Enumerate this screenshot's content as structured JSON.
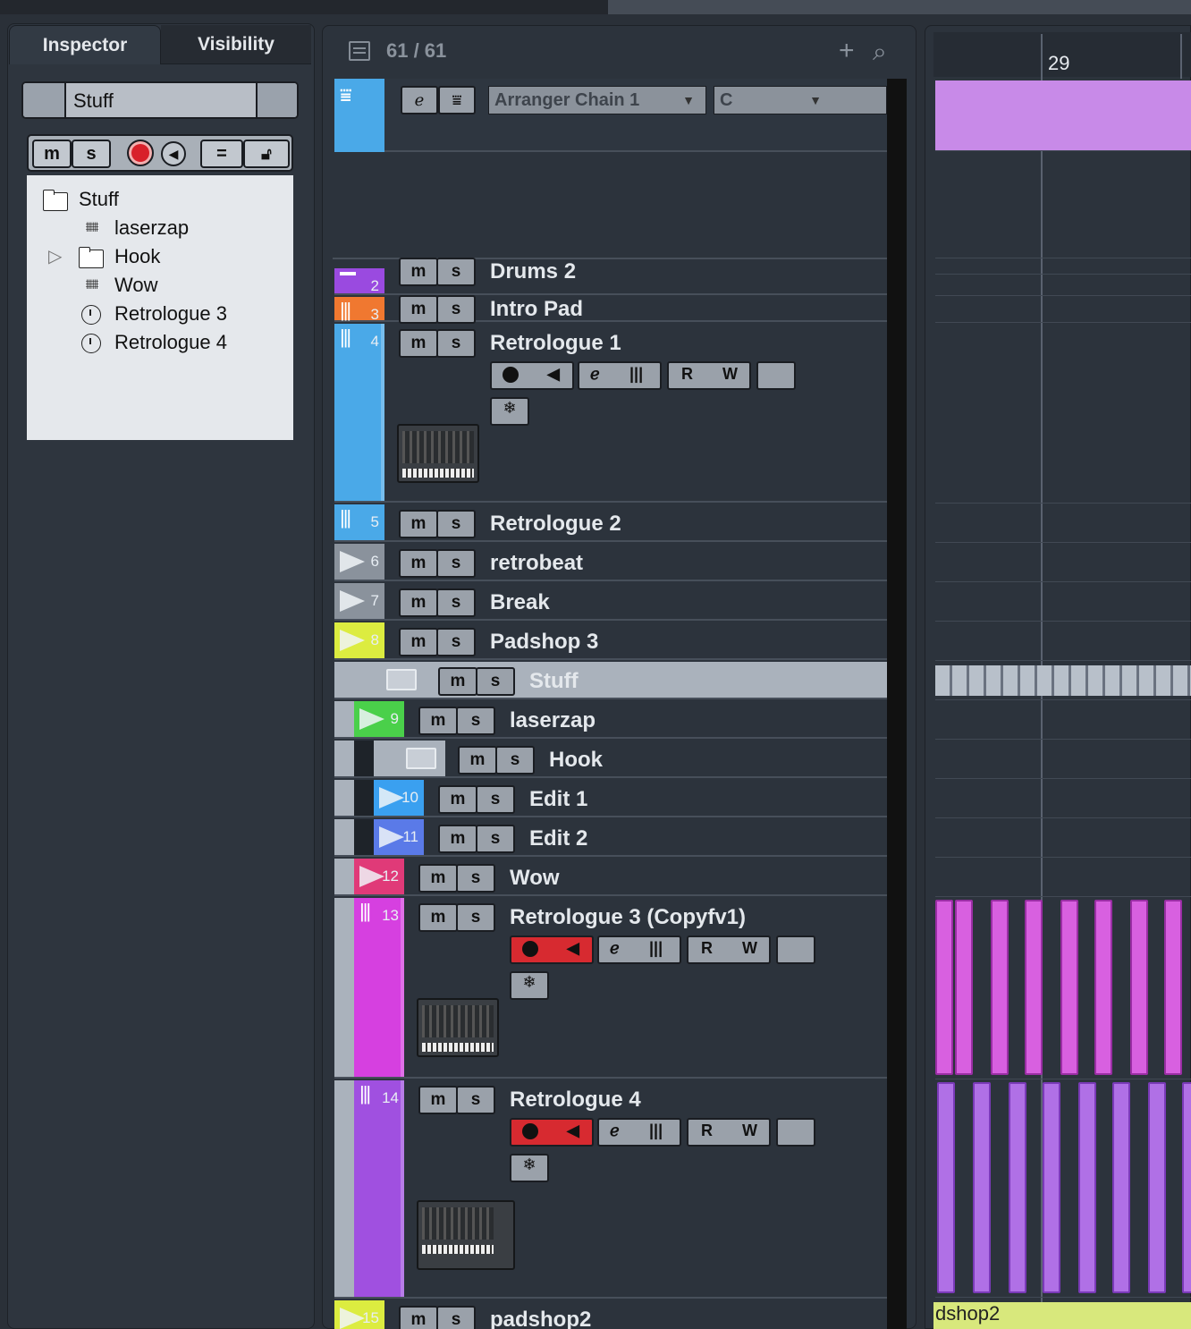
{
  "inspector": {
    "tabs": [
      "Inspector",
      "Visibility"
    ],
    "selected_track": "Stuff",
    "buttons": {
      "mute": "m",
      "solo": "s"
    },
    "tree": [
      {
        "label": "Stuff",
        "icon": "folder-icon"
      },
      {
        "label": "laserzap",
        "icon": "audio-track-icon"
      },
      {
        "label": "Hook",
        "icon": "folder-icon"
      },
      {
        "label": "Wow",
        "icon": "audio-track-icon"
      },
      {
        "label": "Retrologue 3",
        "icon": "instrument-track-icon"
      },
      {
        "label": "Retrologue 4",
        "icon": "instrument-track-icon"
      }
    ]
  },
  "tracklist": {
    "count": "61 / 61",
    "arranger": {
      "chain": "Arranger Chain 1",
      "mode": "C"
    },
    "tracks": [
      {
        "num": "2",
        "name": "Drums 2",
        "color": "#9a4ae0"
      },
      {
        "num": "3",
        "name": "Intro Pad",
        "color": "#f07830"
      },
      {
        "num": "4",
        "name": "Retrologue 1",
        "color": "#4aa9e8"
      },
      {
        "num": "5",
        "name": "Retrologue 2",
        "color": "#4aa9e8"
      },
      {
        "num": "6",
        "name": "retrobeat",
        "color": "#8a929c"
      },
      {
        "num": "7",
        "name": "Break",
        "color": "#8a929c"
      },
      {
        "num": "8",
        "name": "Padshop 3",
        "color": "#dcec40"
      },
      {
        "num": "",
        "name": "Stuff",
        "color": "#aab2bc"
      },
      {
        "num": "9",
        "name": "laserzap",
        "color": "#4ad04a"
      },
      {
        "num": "",
        "name": "Hook",
        "color": "#aab2bc"
      },
      {
        "num": "10",
        "name": "Edit 1",
        "color": "#3aa0f0"
      },
      {
        "num": "11",
        "name": "Edit 2",
        "color": "#5a7ae8"
      },
      {
        "num": "12",
        "name": "Wow",
        "color": "#e03a78"
      },
      {
        "num": "13",
        "name": "Retrologue 3 (Copyfv1)",
        "color": "#d640e0"
      },
      {
        "num": "14",
        "name": "Retrologue 4",
        "color": "#a050e0"
      },
      {
        "num": "15",
        "name": "padshop2",
        "color": "#dcec40"
      }
    ],
    "m_label": "m",
    "s_label": "s",
    "r_label": "R",
    "w_label": "W"
  },
  "ruler": {
    "bar": "29"
  },
  "clip_label": "dshop2"
}
